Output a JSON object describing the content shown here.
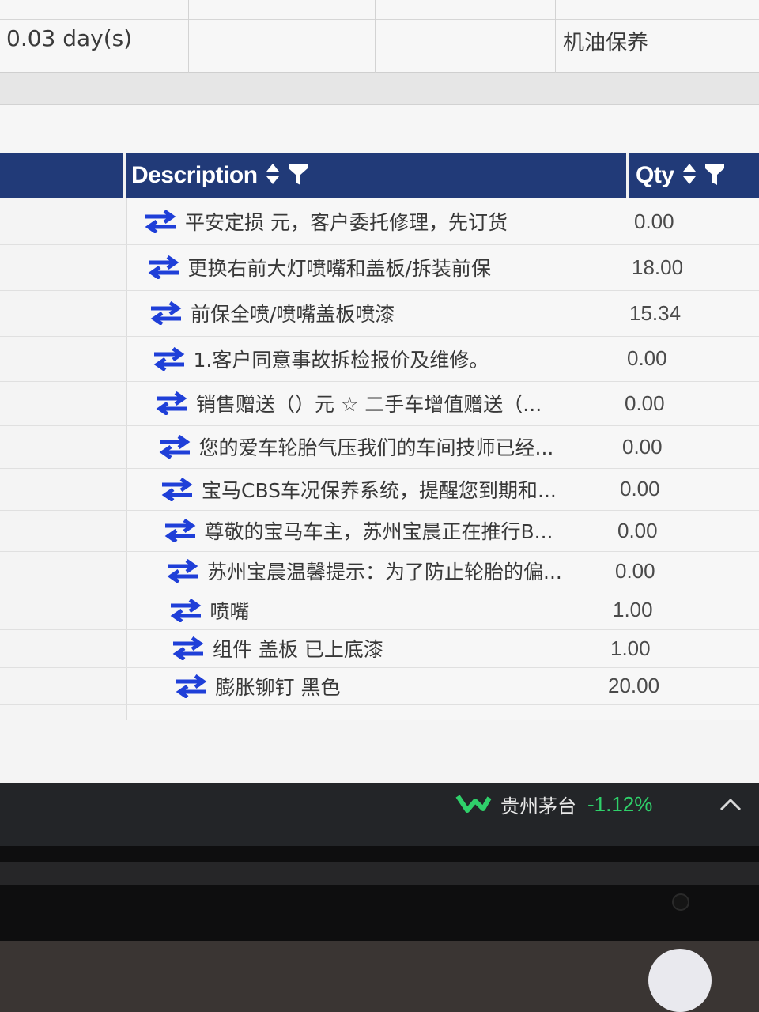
{
  "top_table": {
    "duration": "0.03 day(s)",
    "job_type": "机油保养"
  },
  "grid": {
    "headers": {
      "description": "Description",
      "qty": "Qty"
    },
    "rows": [
      {
        "description": "平安定损 元，客户委托修理，先订货",
        "qty": "0.00"
      },
      {
        "description": "更换右前大灯喷嘴和盖板/拆装前保",
        "qty": "18.00"
      },
      {
        "description": "前保全喷/喷嘴盖板喷漆",
        "qty": "15.34"
      },
      {
        "description": "1.客户同意事故拆检报价及维修。",
        "qty": "0.00"
      },
      {
        "description": "销售赠送（）元 ☆ 二手车增值赠送（...",
        "qty": "0.00"
      },
      {
        "description": "您的爱车轮胎气压我们的车间技师已经...",
        "qty": "0.00"
      },
      {
        "description": "宝马CBS车况保养系统，提醒您到期和...",
        "qty": "0.00"
      },
      {
        "description": "尊敬的宝马车主，苏州宝晨正在推行B...",
        "qty": "0.00"
      },
      {
        "description": "苏州宝晨温馨提示：为了防止轮胎的偏...",
        "qty": "0.00"
      },
      {
        "description": "喷嘴",
        "qty": "1.00"
      },
      {
        "description": "组件 盖板 已上底漆",
        "qty": "1.00"
      },
      {
        "description": "膨胀铆钉 黑色",
        "qty": "20.00"
      }
    ]
  },
  "taskbar": {
    "stock_name": "贵州茅台",
    "stock_change": "-1.12%"
  },
  "icons": {
    "row_icon": "swap-arrows-icon",
    "sort": "sort-icon",
    "filter": "filter-icon",
    "stock": "stock-trend-icon",
    "tray": "chevron-up-icon"
  },
  "colors": {
    "header_bg": "#213a78",
    "swap_icon": "#1f3fd8",
    "stock_change": "#2fd06a"
  }
}
